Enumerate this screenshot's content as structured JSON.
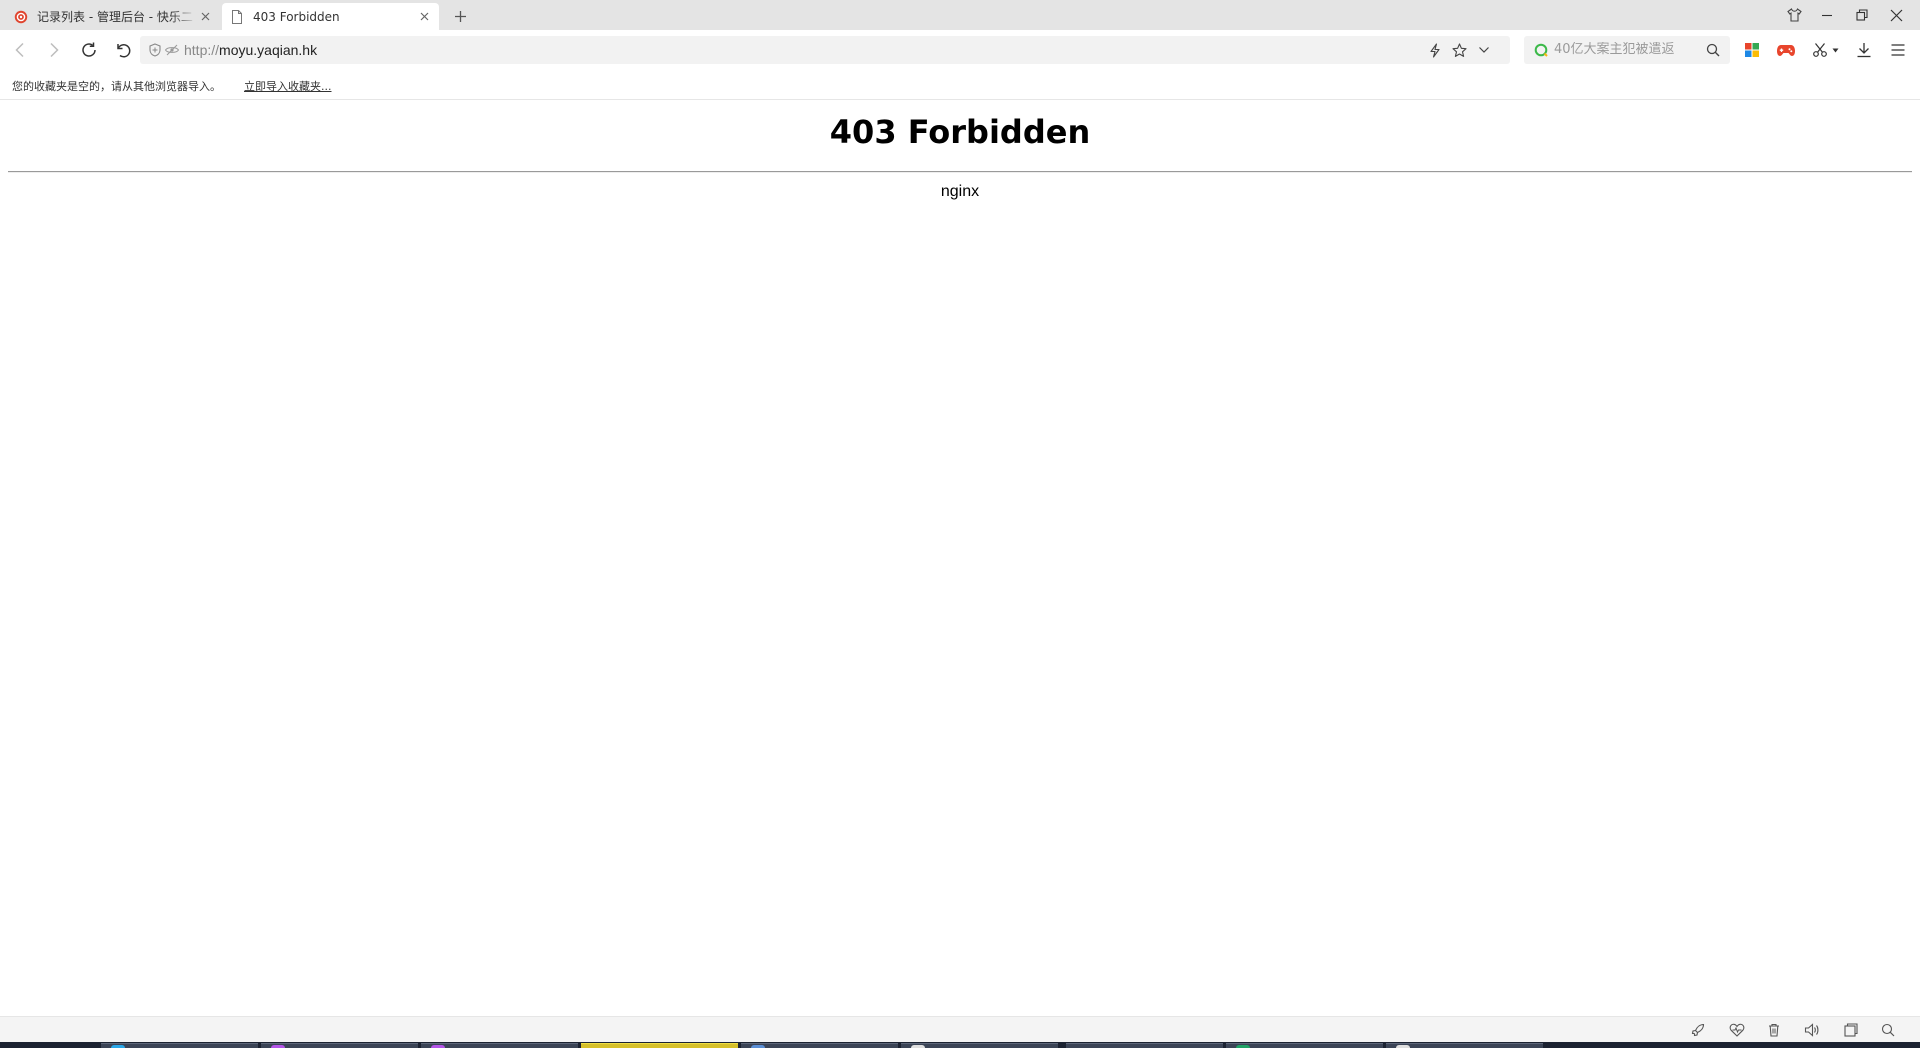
{
  "tabs": [
    {
      "title": "记录列表 - 管理后台 - 快乐二",
      "favicon": "app-logo-icon",
      "active": false
    },
    {
      "title": "403 Forbidden",
      "favicon": "page-icon",
      "active": true
    }
  ],
  "window_controls": [
    "skin-icon",
    "minimize-icon",
    "restore-icon",
    "close-icon"
  ],
  "navigation": {
    "buttons": [
      "back-icon",
      "forward-icon",
      "reload-icon",
      "undo-icon"
    ],
    "security_icons": [
      "shield-icon",
      "eye-off-icon"
    ],
    "url_scheme": "http://",
    "url_host": "moyu.yaqian.hk",
    "address_actions": [
      "lightning-icon",
      "star-icon",
      "chevron-down-icon"
    ]
  },
  "search": {
    "placeholder": "40亿大案主犯被遣返",
    "logo": "search-engine-logo-icon",
    "button": "search-icon"
  },
  "toolbar_icons": [
    "apps-grid-icon",
    "game-controller-icon",
    "scissors-icon",
    "dropdown-arrow-icon",
    "download-icon",
    "menu-icon"
  ],
  "bookmarks_bar": {
    "message": "您的收藏夹是空的，请从其他浏览器导入。",
    "import_link": "立即导入收藏夹..."
  },
  "page": {
    "heading": "403 Forbidden",
    "server": "nginx"
  },
  "status_bar_icons": [
    "rocket-icon",
    "heart-icon",
    "trash-icon",
    "speaker-icon",
    "window-icon",
    "zoom-icon"
  ],
  "colors": {
    "tab_strip": "#e4e4e4",
    "address_bar": "#f2f2f2",
    "taskbar": "#1b2231",
    "active_task": "#d6c02a",
    "game_icon": "#e8452c"
  }
}
